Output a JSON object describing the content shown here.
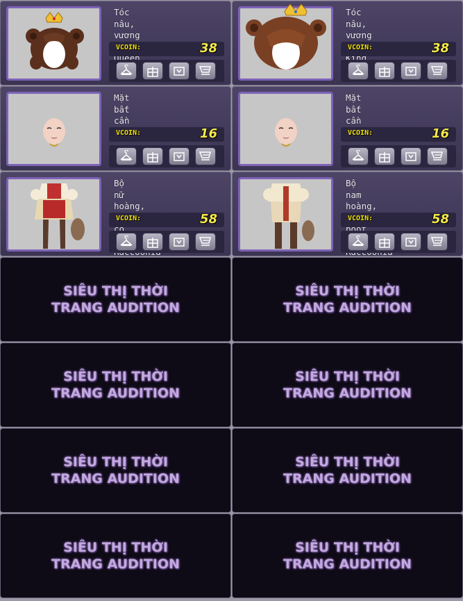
{
  "currency_label": "VCOIN:",
  "placeholder_text": "SIÊU THỊ THỜI TRANG AUDITION",
  "buttons": {
    "try": "hanger-icon",
    "gift": "gift-icon",
    "wishlist": "bag-icon",
    "cart": "cart-icon"
  },
  "items": [
    {
      "name": "Tóc nâu, vương miện Queen Raccoonia",
      "price": "38",
      "image": "hair-queen-icon"
    },
    {
      "name": "Tóc nâu, vương miện King Raccoonia",
      "price": "38",
      "image": "hair-king-icon"
    },
    {
      "name": "Mặt bất cần",
      "price": "16",
      "image": "face-icon"
    },
    {
      "name": "Mặt bất cần",
      "price": "16",
      "image": "face-icon"
    },
    {
      "name": "Bộ nữ hoàng, găng cổ lông, Raccoonia",
      "price": "58",
      "image": "queen-outfit-icon"
    },
    {
      "name": "Bộ nam hoàng, găng boot cao, Raccoonia",
      "price": "58",
      "image": "king-outfit-icon"
    }
  ],
  "colors": {
    "card_bg": "#4d4466",
    "thumb_border": "#7d62b8",
    "price_text": "#f5e94a",
    "placeholder_bg": "#0e0a16",
    "placeholder_text": "#c4a8e0"
  }
}
